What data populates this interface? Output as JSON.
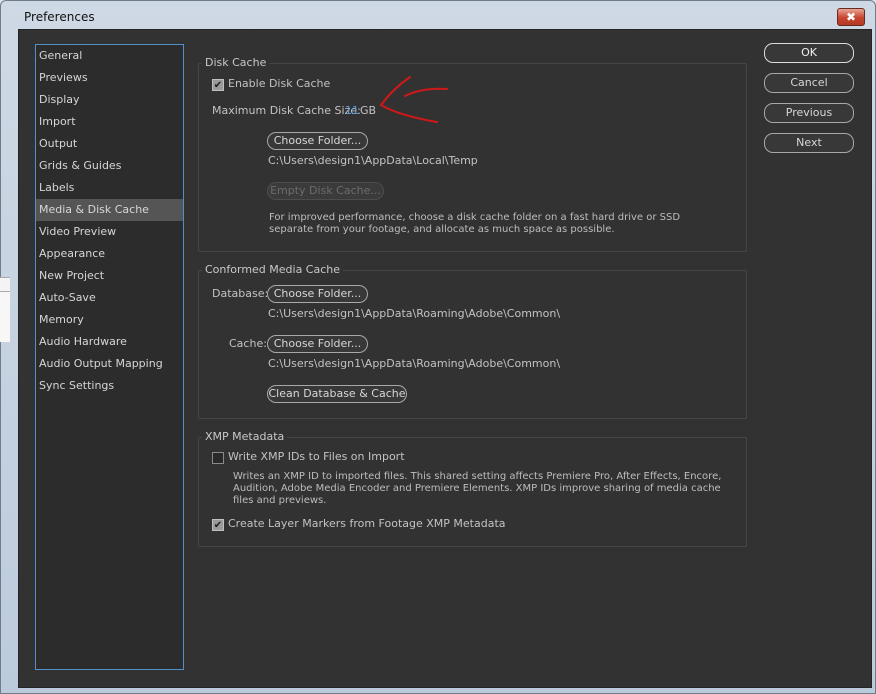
{
  "window": {
    "title": "Preferences",
    "close_glyph": "✖"
  },
  "sidebar": {
    "items": [
      {
        "label": "General"
      },
      {
        "label": "Previews"
      },
      {
        "label": "Display"
      },
      {
        "label": "Import"
      },
      {
        "label": "Output"
      },
      {
        "label": "Grids & Guides"
      },
      {
        "label": "Labels"
      },
      {
        "label": "Media & Disk Cache"
      },
      {
        "label": "Video Preview"
      },
      {
        "label": "Appearance"
      },
      {
        "label": "New Project"
      },
      {
        "label": "Auto-Save"
      },
      {
        "label": "Memory"
      },
      {
        "label": "Audio Hardware"
      },
      {
        "label": "Audio Output Mapping"
      },
      {
        "label": "Sync Settings"
      }
    ],
    "selected": "Media & Disk Cache"
  },
  "disk_cache": {
    "title": "Disk Cache",
    "enable_label": "Enable Disk Cache",
    "enabled": true,
    "max_size_label": "Maximum Disk Cache Size:",
    "max_size_value": "11",
    "max_size_unit": "GB",
    "choose_folder": "Choose Folder...",
    "path": "C:\\Users\\design1\\AppData\\Local\\Temp",
    "empty_button": "Empty Disk Cache...",
    "hint": "For improved performance, choose a disk cache folder on a fast hard drive or SSD separate from your footage, and allocate as much space as possible."
  },
  "conformed_cache": {
    "title": "Conformed Media Cache",
    "database_label": "Database:",
    "database_button": "Choose Folder...",
    "database_path": "C:\\Users\\design1\\AppData\\Roaming\\Adobe\\Common\\",
    "cache_label": "Cache:",
    "cache_button": "Choose Folder...",
    "cache_path": "C:\\Users\\design1\\AppData\\Roaming\\Adobe\\Common\\",
    "clean_button": "Clean Database & Cache"
  },
  "xmp": {
    "title": "XMP Metadata",
    "write_ids_label": "Write XMP IDs to Files on Import",
    "write_ids_checked": false,
    "write_ids_desc": "Writes an XMP ID to imported files. This shared setting affects Premiere Pro, After Effects, Encore, Audition, Adobe Media Encoder and Premiere Elements. XMP IDs improve sharing of media cache files and previews.",
    "layer_markers_label": "Create Layer Markers from Footage XMP Metadata",
    "layer_markers_checked": true
  },
  "actions": {
    "ok": "OK",
    "cancel": "Cancel",
    "previous": "Previous",
    "next": "Next"
  },
  "checkmark_glyph": "✔",
  "annotation_color": "#d01818"
}
